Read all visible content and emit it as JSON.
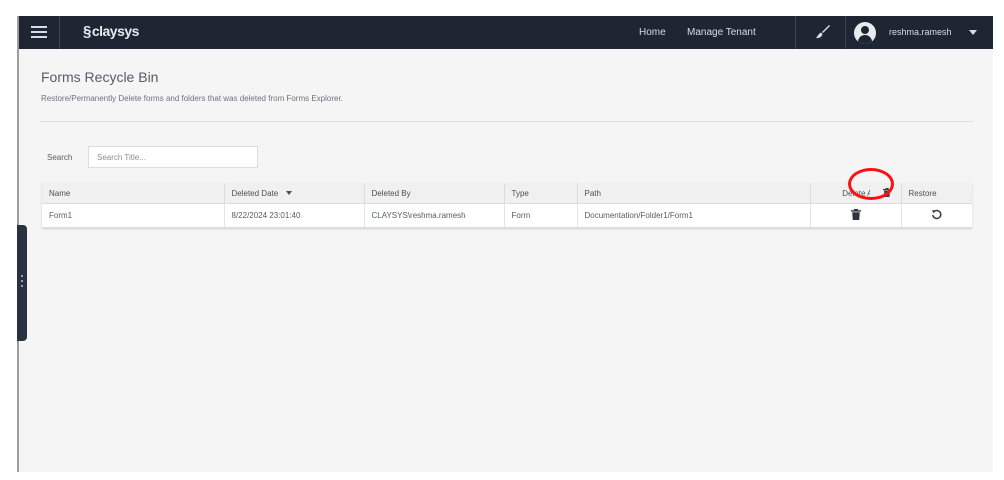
{
  "header": {
    "logo_text": "claysys",
    "nav": [
      {
        "label": "Home"
      },
      {
        "label": "Manage Tenant"
      }
    ],
    "username": "reshma.ramesh",
    "icons": [
      "menu-icon",
      "brush-icon",
      "user-avatar-icon",
      "caret-down-icon"
    ]
  },
  "page": {
    "title": "Forms Recycle Bin",
    "subtitle": "Restore/Permanently Delete forms and folders that was deleted from Forms Explorer."
  },
  "search": {
    "label": "Search",
    "placeholder": "Search Title...",
    "value": ""
  },
  "table": {
    "columns": {
      "name": "Name",
      "deleted_date": "Deleted Date",
      "deleted_by": "Deleted By",
      "type": "Type",
      "path": "Path",
      "delete": "Delete All",
      "restore": "Restore"
    },
    "rows": [
      {
        "name": "Form1",
        "deleted_date": "8/22/2024 23:01:40",
        "deleted_by": "CLAYSYS\\reshma.ramesh",
        "type": "Form",
        "path": "Documentation/Folder1/Form1"
      }
    ]
  },
  "annotation": {
    "color": "#ff1010",
    "target": "delete-all-button"
  },
  "colors": {
    "topbar": "#1e2633",
    "background": "#f5f5f5",
    "highlight": "#ff1010"
  }
}
